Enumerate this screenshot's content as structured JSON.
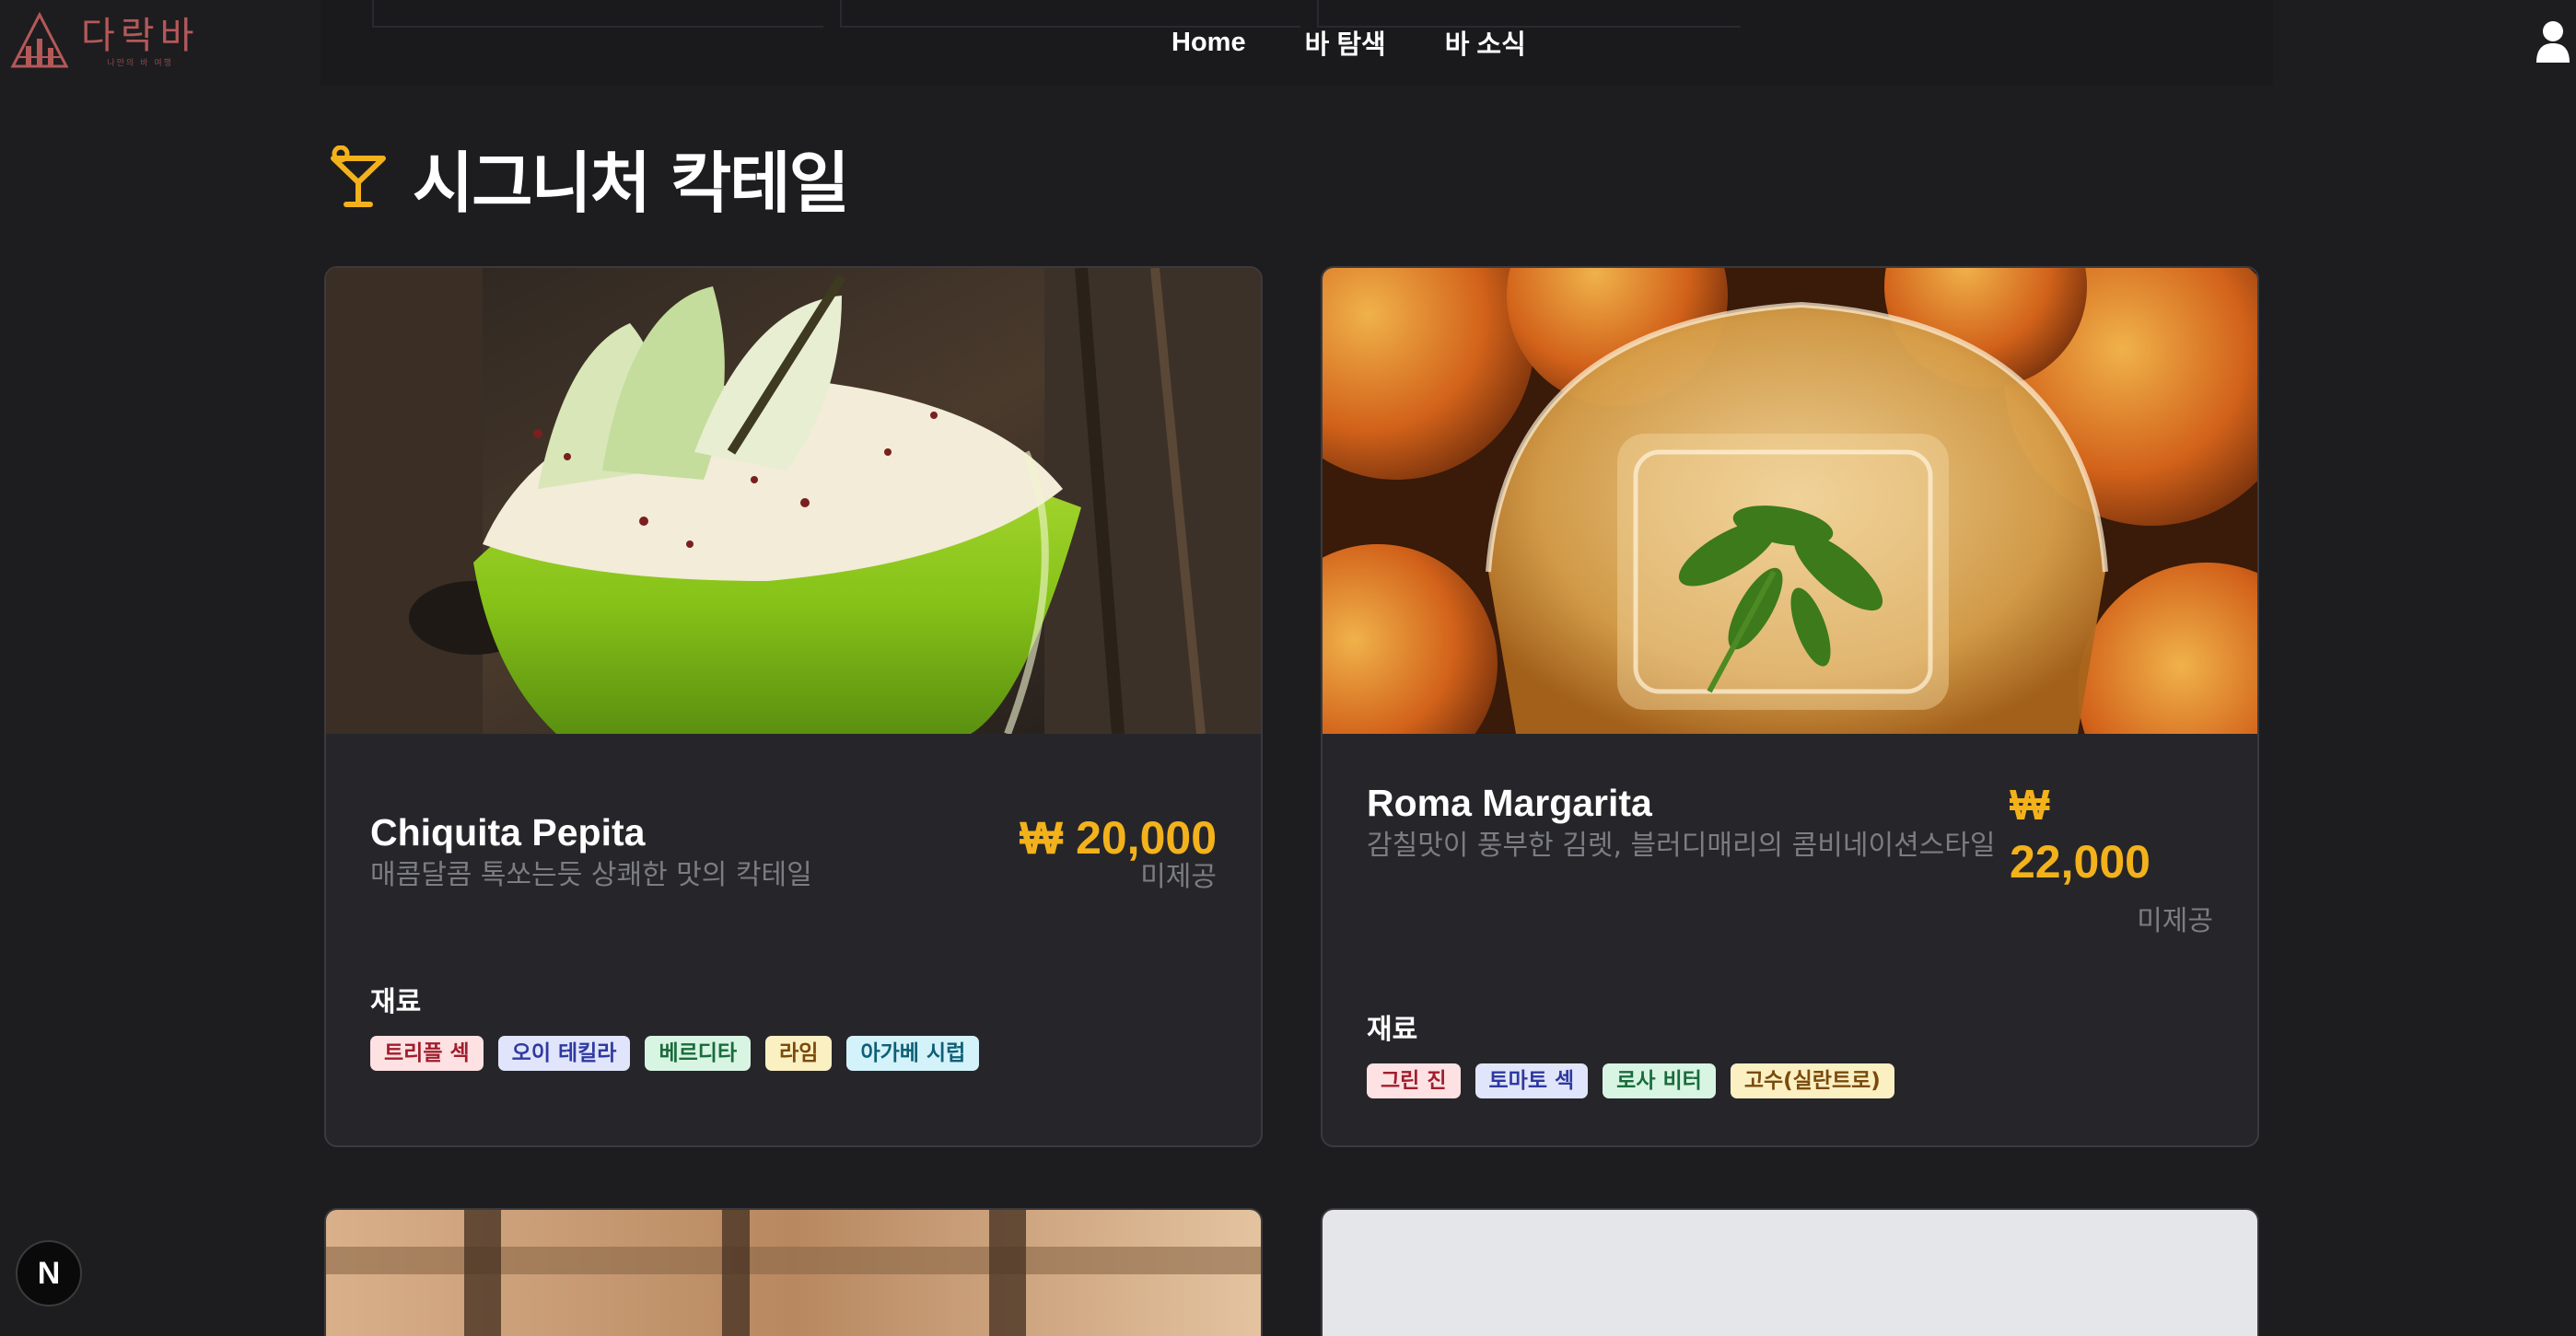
{
  "header": {
    "logo_title": "다락바",
    "logo_subtitle": "나만의 바 여행",
    "nav": [
      "Home",
      "바 탐색",
      "바 소식"
    ]
  },
  "section": {
    "title": "시그니처 칵테일"
  },
  "cards": [
    {
      "name": "Chiquita Pepita",
      "description": "매콤달콤 톡쏘는듯 상쾌한 맛의 칵테일",
      "price": "₩ 20,000",
      "status": "미제공",
      "ingredients_label": "재료",
      "ingredients": [
        "트리플 섹",
        "오이 테킬라",
        "베르디타",
        "라임",
        "아가베 시럽"
      ]
    },
    {
      "name": "Roma Margarita",
      "description": "감칠맛이 풍부한 김렛, 블러디매리의 콤비네이션스타일",
      "price_symbol": "₩",
      "price_value": "22,000",
      "status": "미제공",
      "ingredients_label": "재료",
      "ingredients": [
        "그린 진",
        "토마토 섹",
        "로사 비터",
        "고수(실란트로)"
      ]
    }
  ],
  "colors": {
    "background": "#1d1d20",
    "card": "#26262a",
    "accent_price": "#f3b21b",
    "muted_text": "#7c7c84"
  },
  "badge": "N"
}
